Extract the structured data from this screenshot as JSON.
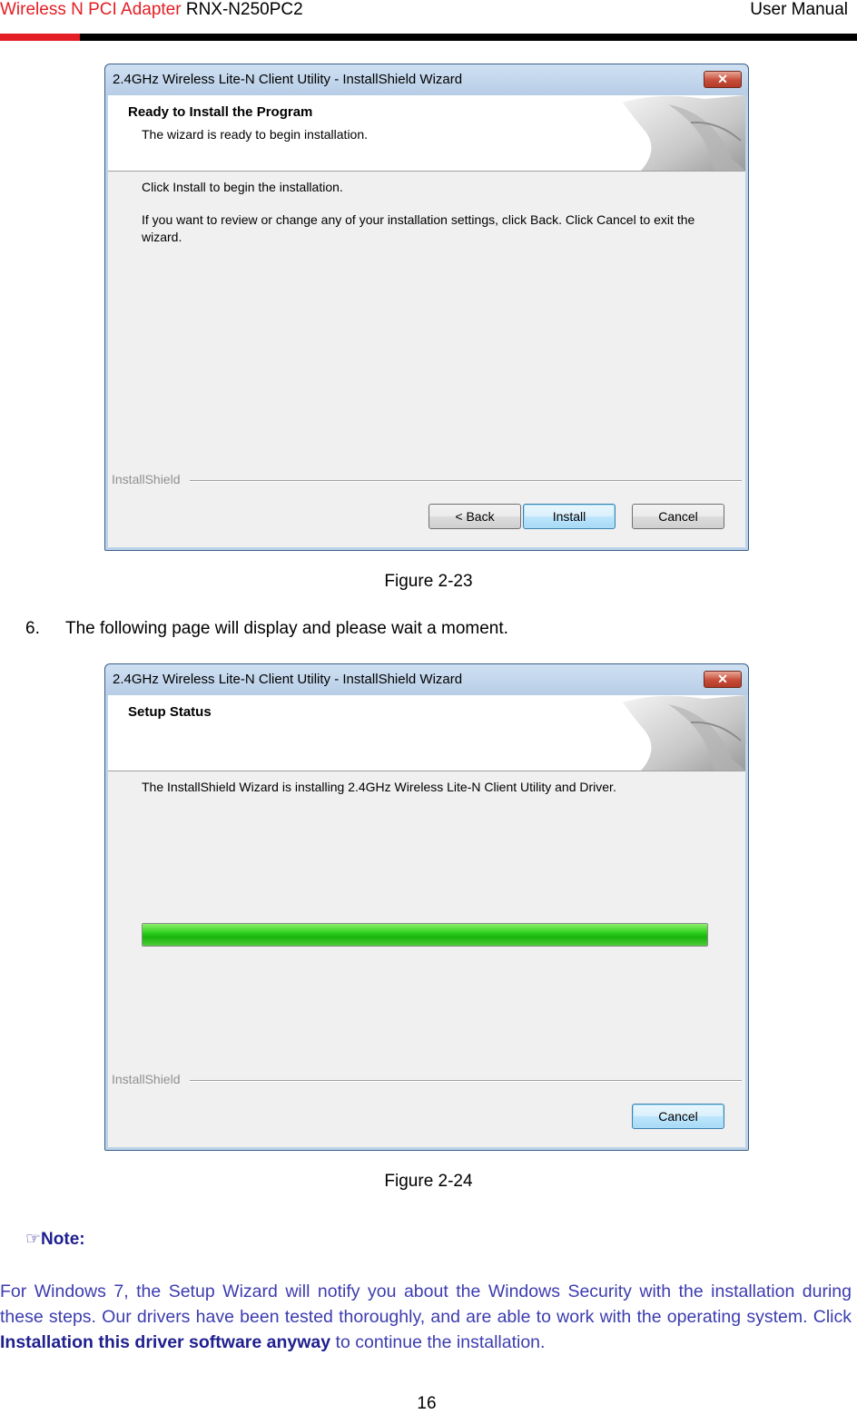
{
  "header": {
    "product_red": "Wireless N PCI Adapter",
    "model": "RNX-N250PC2",
    "doc_type": "User Manual"
  },
  "figure23": {
    "window_title": "2.4GHz Wireless Lite-N Client Utility - InstallShield Wizard",
    "close_glyph": "✕",
    "banner_title": "Ready to Install the Program",
    "banner_subtitle": "The wizard is ready to begin installation.",
    "body_line1": "Click Install to begin the installation.",
    "body_line2": "If you want to review or change any of your installation settings, click Back. Click Cancel to exit the wizard.",
    "installshield_label": "InstallShield",
    "buttons": {
      "back": "< Back",
      "install": "Install",
      "cancel": "Cancel"
    },
    "caption": "Figure 2-23"
  },
  "step6": {
    "number": "6.",
    "text": "The following page will display and please wait a moment."
  },
  "figure24": {
    "window_title": "2.4GHz Wireless Lite-N Client Utility - InstallShield Wizard",
    "close_glyph": "✕",
    "banner_title": "Setup Status",
    "body_line1": "The InstallShield Wizard is installing 2.4GHz Wireless Lite-N Client Utility and Driver.",
    "installshield_label": "InstallShield",
    "progress_fraction": 1.0,
    "buttons": {
      "cancel": "Cancel"
    },
    "caption": "Figure 2-24"
  },
  "note": {
    "icon": "pointing-hand-icon",
    "hand_glyph": "☞",
    "heading": "Note:",
    "text_before": "For Windows 7, the Setup Wizard will notify you about the Windows Security with the installation during  these  steps.  Our  drivers  have  been  tested  thoroughly,  and  are  able  to  work  with  the operating system. Click ",
    "bold_text": "Installation this driver software anyway",
    "text_after": " to continue the installation."
  },
  "footer": {
    "page_number": "16"
  },
  "colors": {
    "brand_red": "#e31e24",
    "note_blue": "#3c3cb0",
    "progress_green": "#19b40c"
  }
}
